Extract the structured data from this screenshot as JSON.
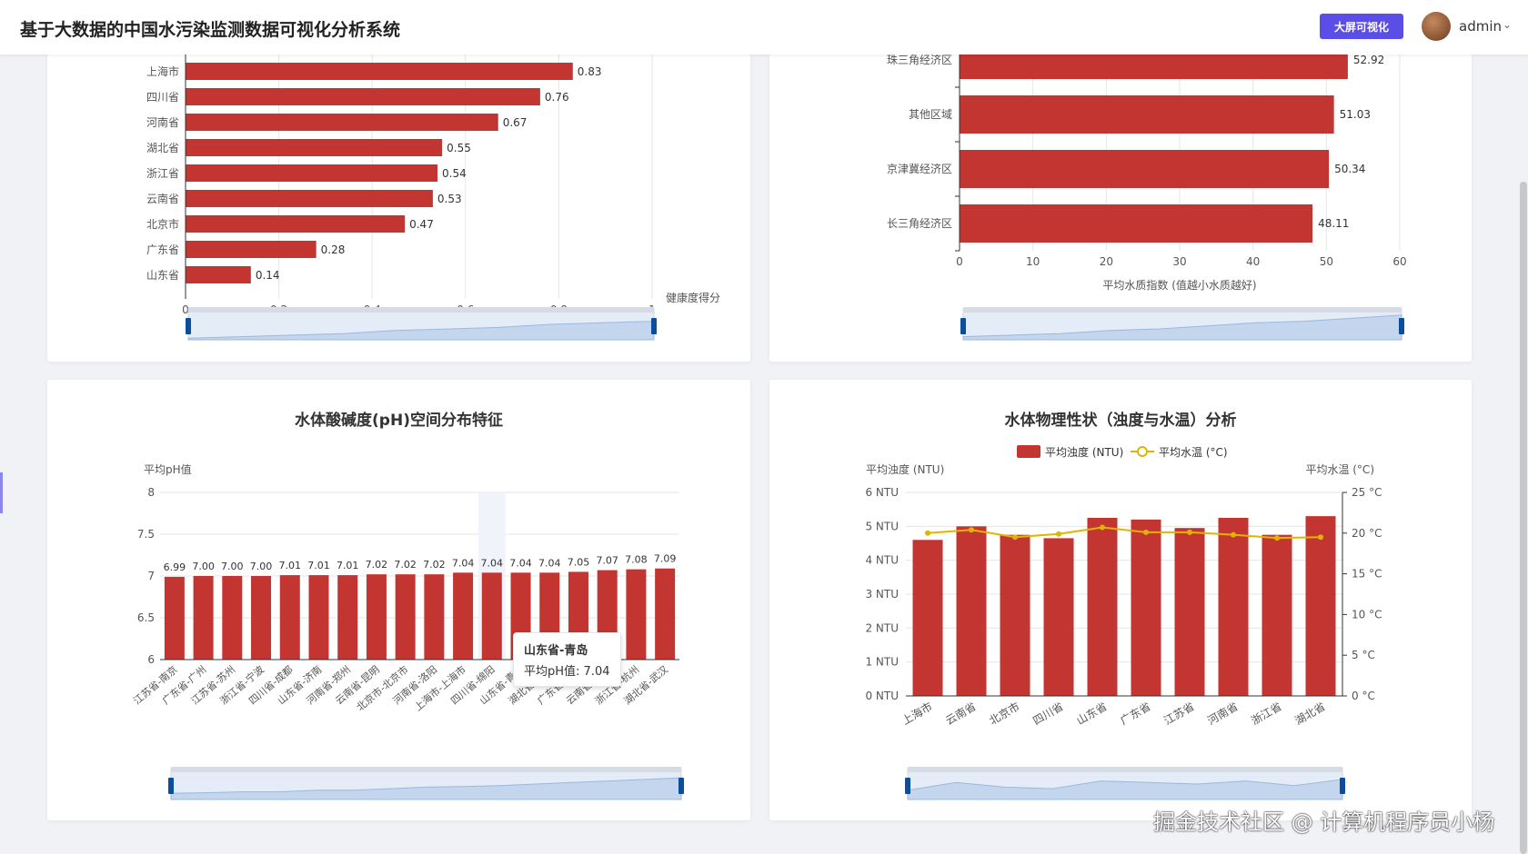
{
  "header": {
    "title": "基于大数据的中国水污染监测数据可视化分析系统",
    "bigscreen_label": "大屏可视化",
    "username": "admin"
  },
  "watermark": "掘金技术社区 @ 计算机程序员小杨",
  "colors": {
    "bar": "#c23531",
    "accent": "#5b4ee6",
    "line": "#e0b400"
  },
  "chart_health": {
    "type": "bar",
    "orientation": "horizontal",
    "categories": [
      "山东省",
      "广东省",
      "北京市",
      "云南省",
      "浙江省",
      "湖北省",
      "河南省",
      "四川省",
      "上海市"
    ],
    "values": [
      0.14,
      0.28,
      0.47,
      0.53,
      0.54,
      0.55,
      0.67,
      0.76,
      0.83
    ],
    "value_labels": [
      "0.14",
      "0.28",
      "0.47",
      "0.53",
      "0.54",
      "0.55",
      "0.67",
      "0.76",
      "0.83"
    ],
    "xlabel": "健康度得分",
    "xlim": [
      0,
      1
    ],
    "xticks": [
      "0",
      "0.2",
      "0.4",
      "0.6",
      "0.8",
      "1"
    ]
  },
  "chart_region": {
    "type": "bar",
    "orientation": "horizontal",
    "categories": [
      "长三角经济区",
      "京津冀经济区",
      "其他区域",
      "珠三角经济区"
    ],
    "values": [
      48.11,
      50.34,
      51.03,
      52.92
    ],
    "value_labels": [
      "48.11",
      "50.34",
      "51.03",
      "52.92"
    ],
    "xlabel": "平均水质指数 (值越小水质越好)",
    "xlim": [
      0,
      60
    ],
    "xticks": [
      "0",
      "10",
      "20",
      "30",
      "40",
      "50",
      "60"
    ]
  },
  "chart_ph": {
    "title": "水体酸碱度(pH)空间分布特征",
    "type": "bar",
    "ylabel": "平均pH值",
    "ylim": [
      6,
      8
    ],
    "yticks": [
      "8",
      "7.5",
      "7",
      "6.5",
      "6"
    ],
    "categories": [
      "江苏省-南京",
      "广东省-广州",
      "江苏省-苏州",
      "浙江省-宁波",
      "四川省-成都",
      "山东省-济南",
      "河南省-郑州",
      "云南省-昆明",
      "北京市-北京市",
      "河南省-洛阳",
      "上海市-上海市",
      "四川省-绵阳",
      "山东省-青岛",
      "湖北省-武汉",
      "广东省-深圳",
      "云南省-大理",
      "浙江省-杭州",
      "湖北省-武汉"
    ],
    "values": [
      6.99,
      7.0,
      7.0,
      7.0,
      7.01,
      7.01,
      7.01,
      7.02,
      7.02,
      7.02,
      7.04,
      7.04,
      7.04,
      7.04,
      7.05,
      7.07,
      7.08,
      7.09
    ],
    "value_labels": [
      "6.99",
      "7.00",
      "7.00",
      "7.00",
      "7.01",
      "7.01",
      "7.01",
      "7.02",
      "7.02",
      "7.02",
      "7.04",
      "7.04",
      "7.04",
      "7.04",
      "7.05",
      "7.07",
      "7.08",
      "7.09"
    ],
    "tooltip": {
      "title": "山东省-青岛",
      "label": "平均pH值: 7.04"
    }
  },
  "chart_physical": {
    "title": "水体物理性状（浊度与水温）分析",
    "type": "bar",
    "categories": [
      "上海市",
      "云南省",
      "北京市",
      "四川省",
      "山东省",
      "广东省",
      "江苏省",
      "河南省",
      "浙江省",
      "湖北省"
    ],
    "series": [
      {
        "name": "平均浊度 (NTU)",
        "type": "bar",
        "values": [
          4.6,
          5.0,
          4.75,
          4.65,
          5.25,
          5.2,
          4.95,
          5.25,
          4.75,
          5.3
        ]
      },
      {
        "name": "平均水温 (°C)",
        "type": "line",
        "values": [
          20.0,
          20.4,
          19.5,
          19.9,
          20.7,
          20.1,
          20.1,
          19.8,
          19.4,
          19.5
        ]
      }
    ],
    "ylabel_left": "平均浊度 (NTU)",
    "ylabel_right": "平均水温 (°C)",
    "ylim_left": [
      0,
      6
    ],
    "ylim_right": [
      0,
      25
    ],
    "yticks_left": [
      "6 NTU",
      "5 NTU",
      "4 NTU",
      "3 NTU",
      "2 NTU",
      "1 NTU",
      "0 NTU"
    ],
    "yticks_right": [
      "25 °C",
      "20 °C",
      "15 °C",
      "10 °C",
      "5 °C",
      "0 °C"
    ],
    "legend_position": "top-center"
  }
}
